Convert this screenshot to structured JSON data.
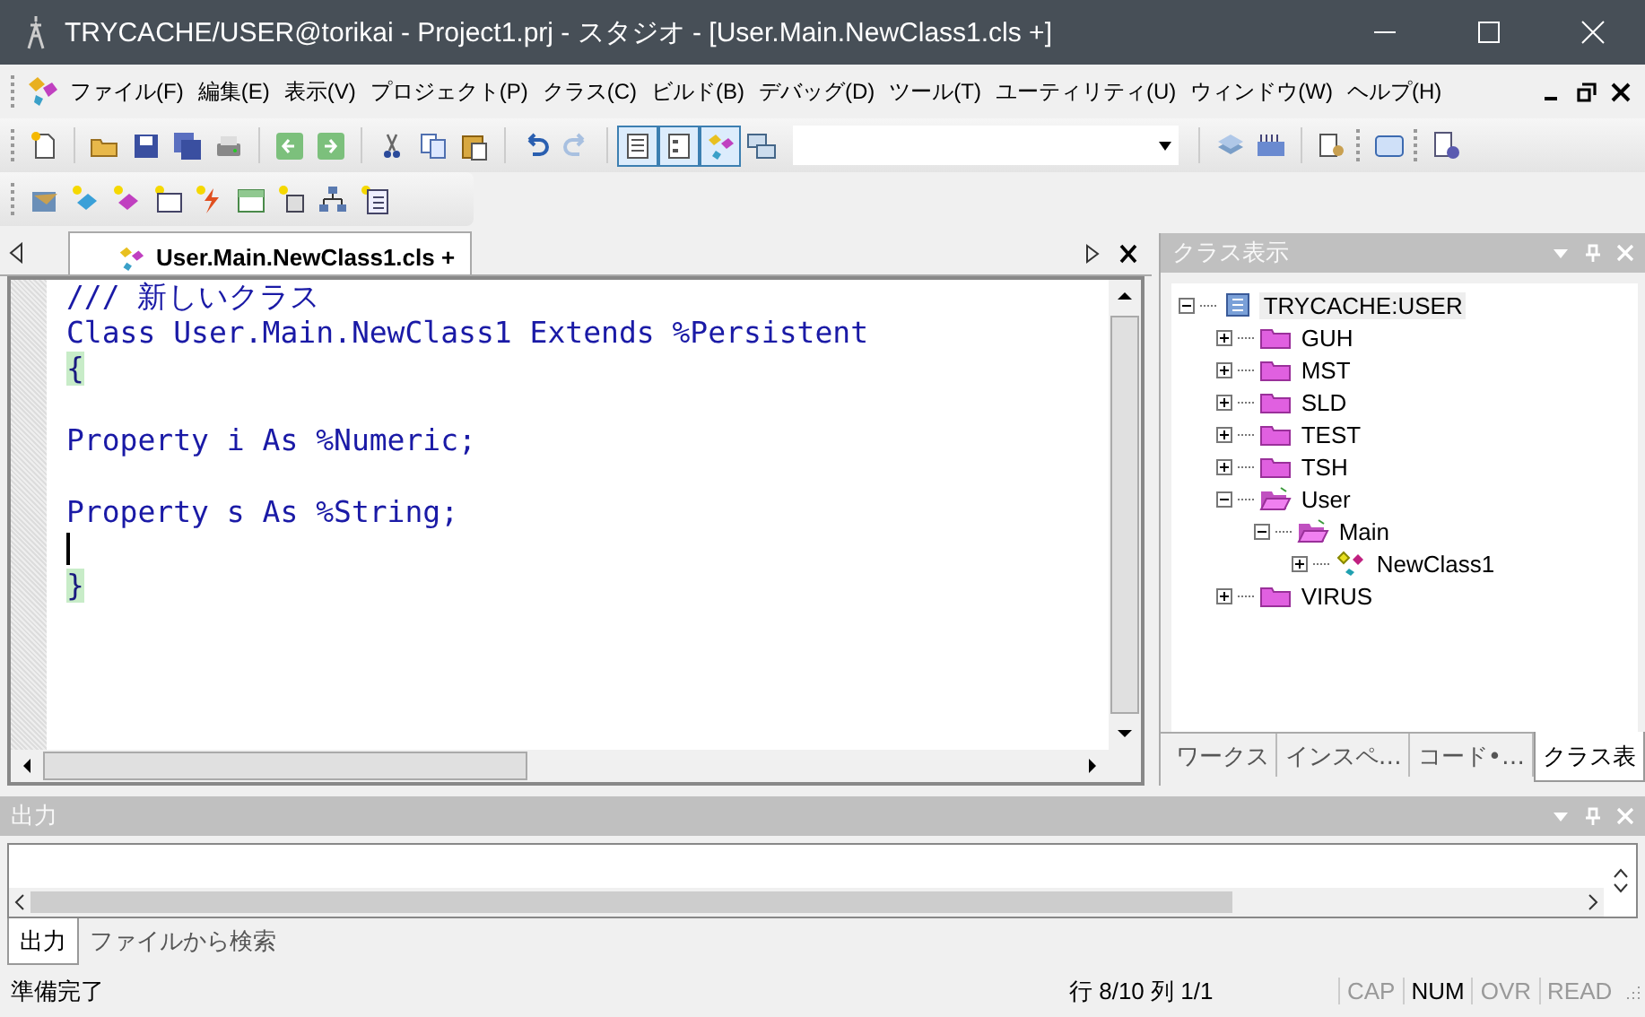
{
  "window": {
    "title": "TRYCACHE/USER@torikai - Project1.prj - スタジオ - [User.Main.NewClass1.cls +]"
  },
  "menu": [
    "ファイル(F)",
    "編集(E)",
    "表示(V)",
    "プロジェクト(P)",
    "クラス(C)",
    "ビルド(B)",
    "デバッグ(D)",
    "ツール(T)",
    "ユーティリティ(U)",
    "ウィンドウ(W)",
    "ヘルプ(H)"
  ],
  "editor": {
    "tab": {
      "label": "User.Main.NewClass1.cls +",
      "selected": true
    },
    "lines": [
      {
        "kind": "comment",
        "text": "/// 新しいクラス"
      },
      {
        "kind": "code",
        "text": "Class User.Main.NewClass1 Extends %Persistent"
      },
      {
        "kind": "brace",
        "text": "{"
      },
      {
        "kind": "blank"
      },
      {
        "kind": "code",
        "text": "Property i As %Numeric;"
      },
      {
        "kind": "blank"
      },
      {
        "kind": "code",
        "text": "Property s As %String;"
      },
      {
        "kind": "cursor"
      },
      {
        "kind": "brace",
        "text": "}"
      }
    ]
  },
  "class_view": {
    "title": "クラス表示",
    "tree": [
      {
        "label": "TRYCACHE:USER",
        "kind": "database",
        "expanded": true,
        "selected": true,
        "children": [
          {
            "label": "GUH",
            "kind": "folder",
            "expanded": false,
            "selected": false
          },
          {
            "label": "MST",
            "kind": "folder",
            "expanded": false,
            "selected": false
          },
          {
            "label": "SLD",
            "kind": "folder",
            "expanded": false,
            "selected": false
          },
          {
            "label": "TEST",
            "kind": "folder",
            "expanded": false,
            "selected": false
          },
          {
            "label": "TSH",
            "kind": "folder",
            "expanded": false,
            "selected": false
          },
          {
            "label": "User",
            "kind": "folder",
            "expanded": true,
            "selected": false,
            "children": [
              {
                "label": "Main",
                "kind": "folder",
                "expanded": true,
                "selected": false,
                "children": [
                  {
                    "label": "NewClass1",
                    "kind": "class",
                    "expanded": false,
                    "selected": false
                  }
                ]
              }
            ]
          },
          {
            "label": "VIRUS",
            "kind": "folder",
            "expanded": false,
            "selected": false
          }
        ]
      }
    ],
    "tabs": [
      {
        "label": "ワークス",
        "selected": false
      },
      {
        "label": "インスペ…",
        "selected": false
      },
      {
        "label": "コード•…",
        "selected": false
      },
      {
        "label": "クラス表",
        "selected": true
      }
    ]
  },
  "output": {
    "title": "出力",
    "tabs": [
      {
        "label": "出力",
        "selected": true
      },
      {
        "label": "ファイルから検索",
        "selected": false
      }
    ]
  },
  "status_bar": {
    "message": "準備完了",
    "position": "行 8/10 列 1/1",
    "indicators": [
      {
        "label": "CAP",
        "on": false
      },
      {
        "label": "NUM",
        "on": true
      },
      {
        "label": "OVR",
        "on": false
      },
      {
        "label": "READ",
        "on": false
      }
    ]
  }
}
